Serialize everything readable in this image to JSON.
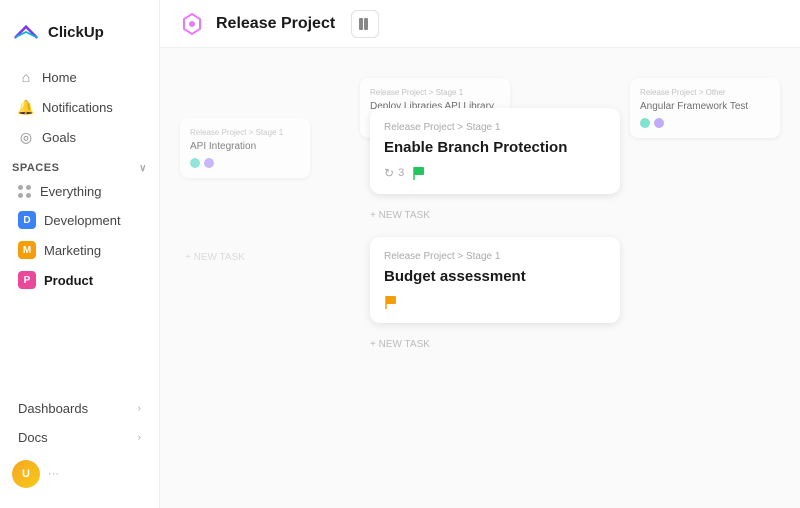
{
  "app": {
    "name": "ClickUp"
  },
  "topbar": {
    "title": "Release Project",
    "icon_color": "#e879f9"
  },
  "sidebar": {
    "nav": [
      {
        "id": "home",
        "label": "Home",
        "icon": "🏠"
      },
      {
        "id": "notifications",
        "label": "Notifications",
        "icon": "🔔"
      },
      {
        "id": "goals",
        "label": "Goals",
        "icon": "🎯"
      }
    ],
    "spaces_label": "Spaces",
    "spaces": [
      {
        "id": "everything",
        "label": "Everything",
        "badge_color": null
      },
      {
        "id": "development",
        "label": "Development",
        "badge": "D",
        "badge_color": "#3b82f6"
      },
      {
        "id": "marketing",
        "label": "Marketing",
        "badge": "M",
        "badge_color": "#f59e0b"
      },
      {
        "id": "product",
        "label": "Product",
        "badge": "P",
        "badge_color": "#ec4899",
        "active": true
      }
    ],
    "sections": [
      {
        "id": "dashboards",
        "label": "Dashboards"
      },
      {
        "id": "docs",
        "label": "Docs"
      }
    ],
    "user": {
      "initials": "U"
    }
  },
  "cards": {
    "left": {
      "breadcrumb": "Release Project > Stage 1",
      "title": "API Integration",
      "badges": [
        "teal",
        "purple"
      ]
    },
    "center_bg": {
      "breadcrumb": "Release Project > Stage 1",
      "title": "Deploy Libraries API Library",
      "badges": [
        "orange"
      ]
    },
    "right_bg": {
      "breadcrumb": "Release Project > Other",
      "title": "Angular Framework Test",
      "badges": [
        "blue",
        "purple"
      ]
    },
    "card1": {
      "breadcrumb": "Release Project > Stage 1",
      "title": "Enable Branch Protection",
      "count": "3",
      "has_flag": true,
      "flag_color": "#22c55e"
    },
    "card2": {
      "breadcrumb": "Release Project > Stage 1",
      "title": "Budget assessment",
      "has_flag": true,
      "flag_color": "#f59e0b"
    }
  },
  "add_task_label": "+ NEW TASK"
}
